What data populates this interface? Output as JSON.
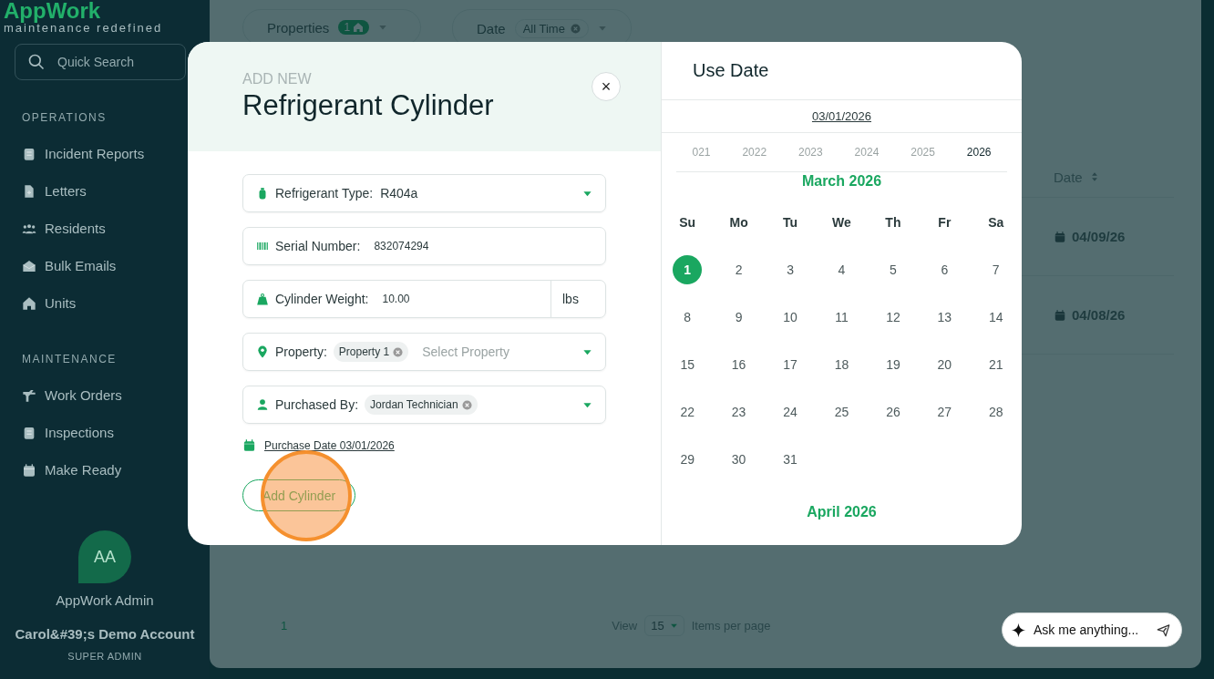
{
  "sidebar": {
    "logo": "AppWork",
    "tagline": "maintenance redefined",
    "search": {
      "placeholder": "Quick Search"
    },
    "sections": [
      {
        "title": "OPERATIONS",
        "items": [
          {
            "label": "Incident Reports"
          },
          {
            "label": "Letters"
          },
          {
            "label": "Residents"
          },
          {
            "label": "Bulk Emails"
          },
          {
            "label": "Units"
          }
        ]
      },
      {
        "title": "MAINTENANCE",
        "items": [
          {
            "label": "Work Orders"
          },
          {
            "label": "Inspections"
          },
          {
            "label": "Make Ready"
          }
        ]
      }
    ],
    "user": {
      "initials": "AA",
      "name": "AppWork Admin",
      "account": "Carol&#39;s Demo Account",
      "role": "SUPER ADMIN"
    }
  },
  "filters": [
    {
      "label": "Properties",
      "badge": "1"
    },
    {
      "label": "Date",
      "chip": "All Time"
    }
  ],
  "table": {
    "columns": [
      {
        "label": "Date"
      }
    ],
    "rows": [
      {
        "date": "04/09/26"
      },
      {
        "date": "04/08/26"
      }
    ]
  },
  "pagination": {
    "page": "1",
    "view_label": "View",
    "per_page": "15",
    "per_page_label": "Items per page"
  },
  "modal": {
    "eyebrow": "ADD NEW",
    "title": "Refrigerant Cylinder",
    "close": "×",
    "fields": [
      {
        "kind": "select",
        "label": "Refrigerant Type:",
        "value": "R404a"
      },
      {
        "kind": "text",
        "label": "Serial Number:",
        "value": "832074294"
      },
      {
        "kind": "unit",
        "label": "Cylinder Weight:",
        "value": "10.00",
        "unit": "lbs"
      },
      {
        "kind": "multiselect",
        "label": "Property:",
        "tags": [
          "Property 1"
        ],
        "placeholder": "Select Property"
      },
      {
        "kind": "multiselect",
        "label": "Purchased By:",
        "tags": [
          "Jordan Technician"
        ]
      }
    ],
    "date_link": "Purchase Date 03/01/2026",
    "submit": {
      "label": "Add Cylinder",
      "clicked": true
    }
  },
  "calendar": {
    "title": "Use Date",
    "date": "03/01/2026",
    "years": [
      {
        "label": "021",
        "selected": false
      },
      {
        "label": "2022",
        "selected": false
      },
      {
        "label": "2023",
        "selected": false
      },
      {
        "label": "2024",
        "selected": false
      },
      {
        "label": "2025",
        "selected": false
      },
      {
        "label": "2026",
        "selected": true
      }
    ],
    "weekdays": [
      "Su",
      "Mo",
      "Tu",
      "We",
      "Th",
      "Fr",
      "Sa"
    ],
    "months": [
      {
        "title": "March 2026",
        "days": [
          {
            "label": "1",
            "selected": true
          },
          {
            "label": "2",
            "selected": false
          },
          {
            "label": "3",
            "selected": false
          },
          {
            "label": "4",
            "selected": false
          },
          {
            "label": "5",
            "selected": false
          },
          {
            "label": "6",
            "selected": false
          },
          {
            "label": "7",
            "selected": false
          },
          {
            "label": "8",
            "selected": false
          },
          {
            "label": "9",
            "selected": false
          },
          {
            "label": "10",
            "selected": false
          },
          {
            "label": "11",
            "selected": false
          },
          {
            "label": "12",
            "selected": false
          },
          {
            "label": "13",
            "selected": false
          },
          {
            "label": "14",
            "selected": false
          },
          {
            "label": "15",
            "selected": false
          },
          {
            "label": "16",
            "selected": false
          },
          {
            "label": "17",
            "selected": false
          },
          {
            "label": "18",
            "selected": false
          },
          {
            "label": "19",
            "selected": false
          },
          {
            "label": "20",
            "selected": false
          },
          {
            "label": "21",
            "selected": false
          },
          {
            "label": "22",
            "selected": false
          },
          {
            "label": "23",
            "selected": false
          },
          {
            "label": "24",
            "selected": false
          },
          {
            "label": "25",
            "selected": false
          },
          {
            "label": "26",
            "selected": false
          },
          {
            "label": "27",
            "selected": false
          },
          {
            "label": "28",
            "selected": false
          },
          {
            "label": "29",
            "selected": false
          },
          {
            "label": "30",
            "selected": false
          },
          {
            "label": "31",
            "selected": false
          }
        ]
      },
      {
        "title": "April 2026"
      }
    ]
  },
  "assistant": {
    "placeholder": "Ask me anything..."
  }
}
